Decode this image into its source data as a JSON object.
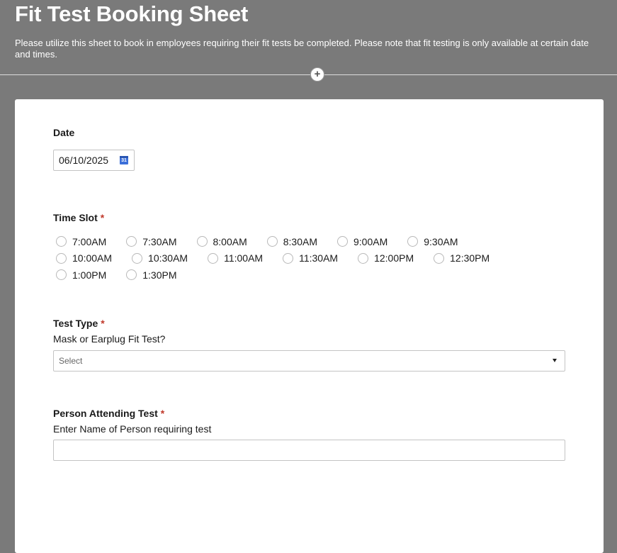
{
  "header": {
    "title": "Fit Test Booking Sheet",
    "description": "Please utilize this sheet to book in employees requiring their fit tests be completed. Please note that fit testing is only available at certain date and times.",
    "add_icon": "plus-icon"
  },
  "form": {
    "date": {
      "label": "Date",
      "value": "06/10/2025",
      "calendar_icon_text": "31"
    },
    "time_slot": {
      "label": "Time Slot",
      "required": "*",
      "options": [
        "7:00AM",
        "7:30AM",
        "8:00AM",
        "8:30AM",
        "9:00AM",
        "9:30AM",
        "10:00AM",
        "10:30AM",
        "11:00AM",
        "11:30AM",
        "12:00PM",
        "12:30PM",
        "1:00PM",
        "1:30PM"
      ]
    },
    "test_type": {
      "label": "Test Type",
      "required": "*",
      "hint": "Mask or Earplug Fit Test?",
      "selected": "Select"
    },
    "person": {
      "label": "Person Attending Test",
      "required": "*",
      "hint": "Enter Name of Person requiring test",
      "value": ""
    }
  },
  "colors": {
    "background": "#7a7a7a",
    "required": "#c0392b",
    "calendar": "#3b6fd9"
  }
}
